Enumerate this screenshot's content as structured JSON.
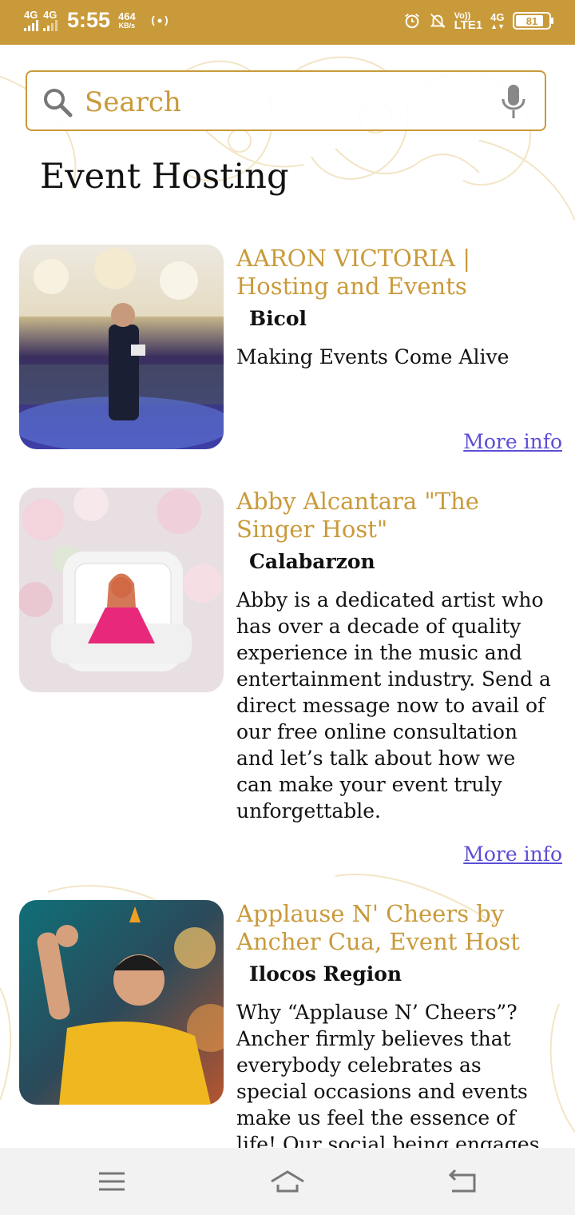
{
  "status_bar": {
    "net1": "4G",
    "net2": "4G",
    "time": "5:55",
    "speed_value": "464",
    "speed_unit": "KB/s",
    "volte": "Vo))",
    "lte": "LTE1",
    "net3": "4G",
    "battery": "81",
    "colors": {
      "bar": "#c99a3a"
    }
  },
  "search": {
    "placeholder": "Search"
  },
  "page": {
    "title": "Event Hosting"
  },
  "listings": [
    {
      "name": "AARON VICTORIA | Hosting and Events",
      "region": "Bicol",
      "description": "Making Events Come Alive",
      "link": "More info"
    },
    {
      "name": "Abby Alcantara \"The Singer Host\"",
      "region": "Calabarzon",
      "description": "Abby is a dedicated artist who has over a decade of quality experience in the music and entertainment industry. Send a direct message now to avail of our free online consultation and let’s talk about how we can make your event truly unforgettable.",
      "link": "More info"
    },
    {
      "name": "Applause N' Cheers by Ancher Cua, Event Host",
      "region": "Ilocos Region",
      "description": "Why “Applause N’ Cheers”? Ancher firmly believes that everybody celebrates as special occasions and events make us feel the essence of life! Our social being engages us to",
      "link": ""
    }
  ],
  "colors": {
    "accent": "#c99a3a",
    "link": "#5b4ed6",
    "nav_bg": "#f2f2f2"
  }
}
